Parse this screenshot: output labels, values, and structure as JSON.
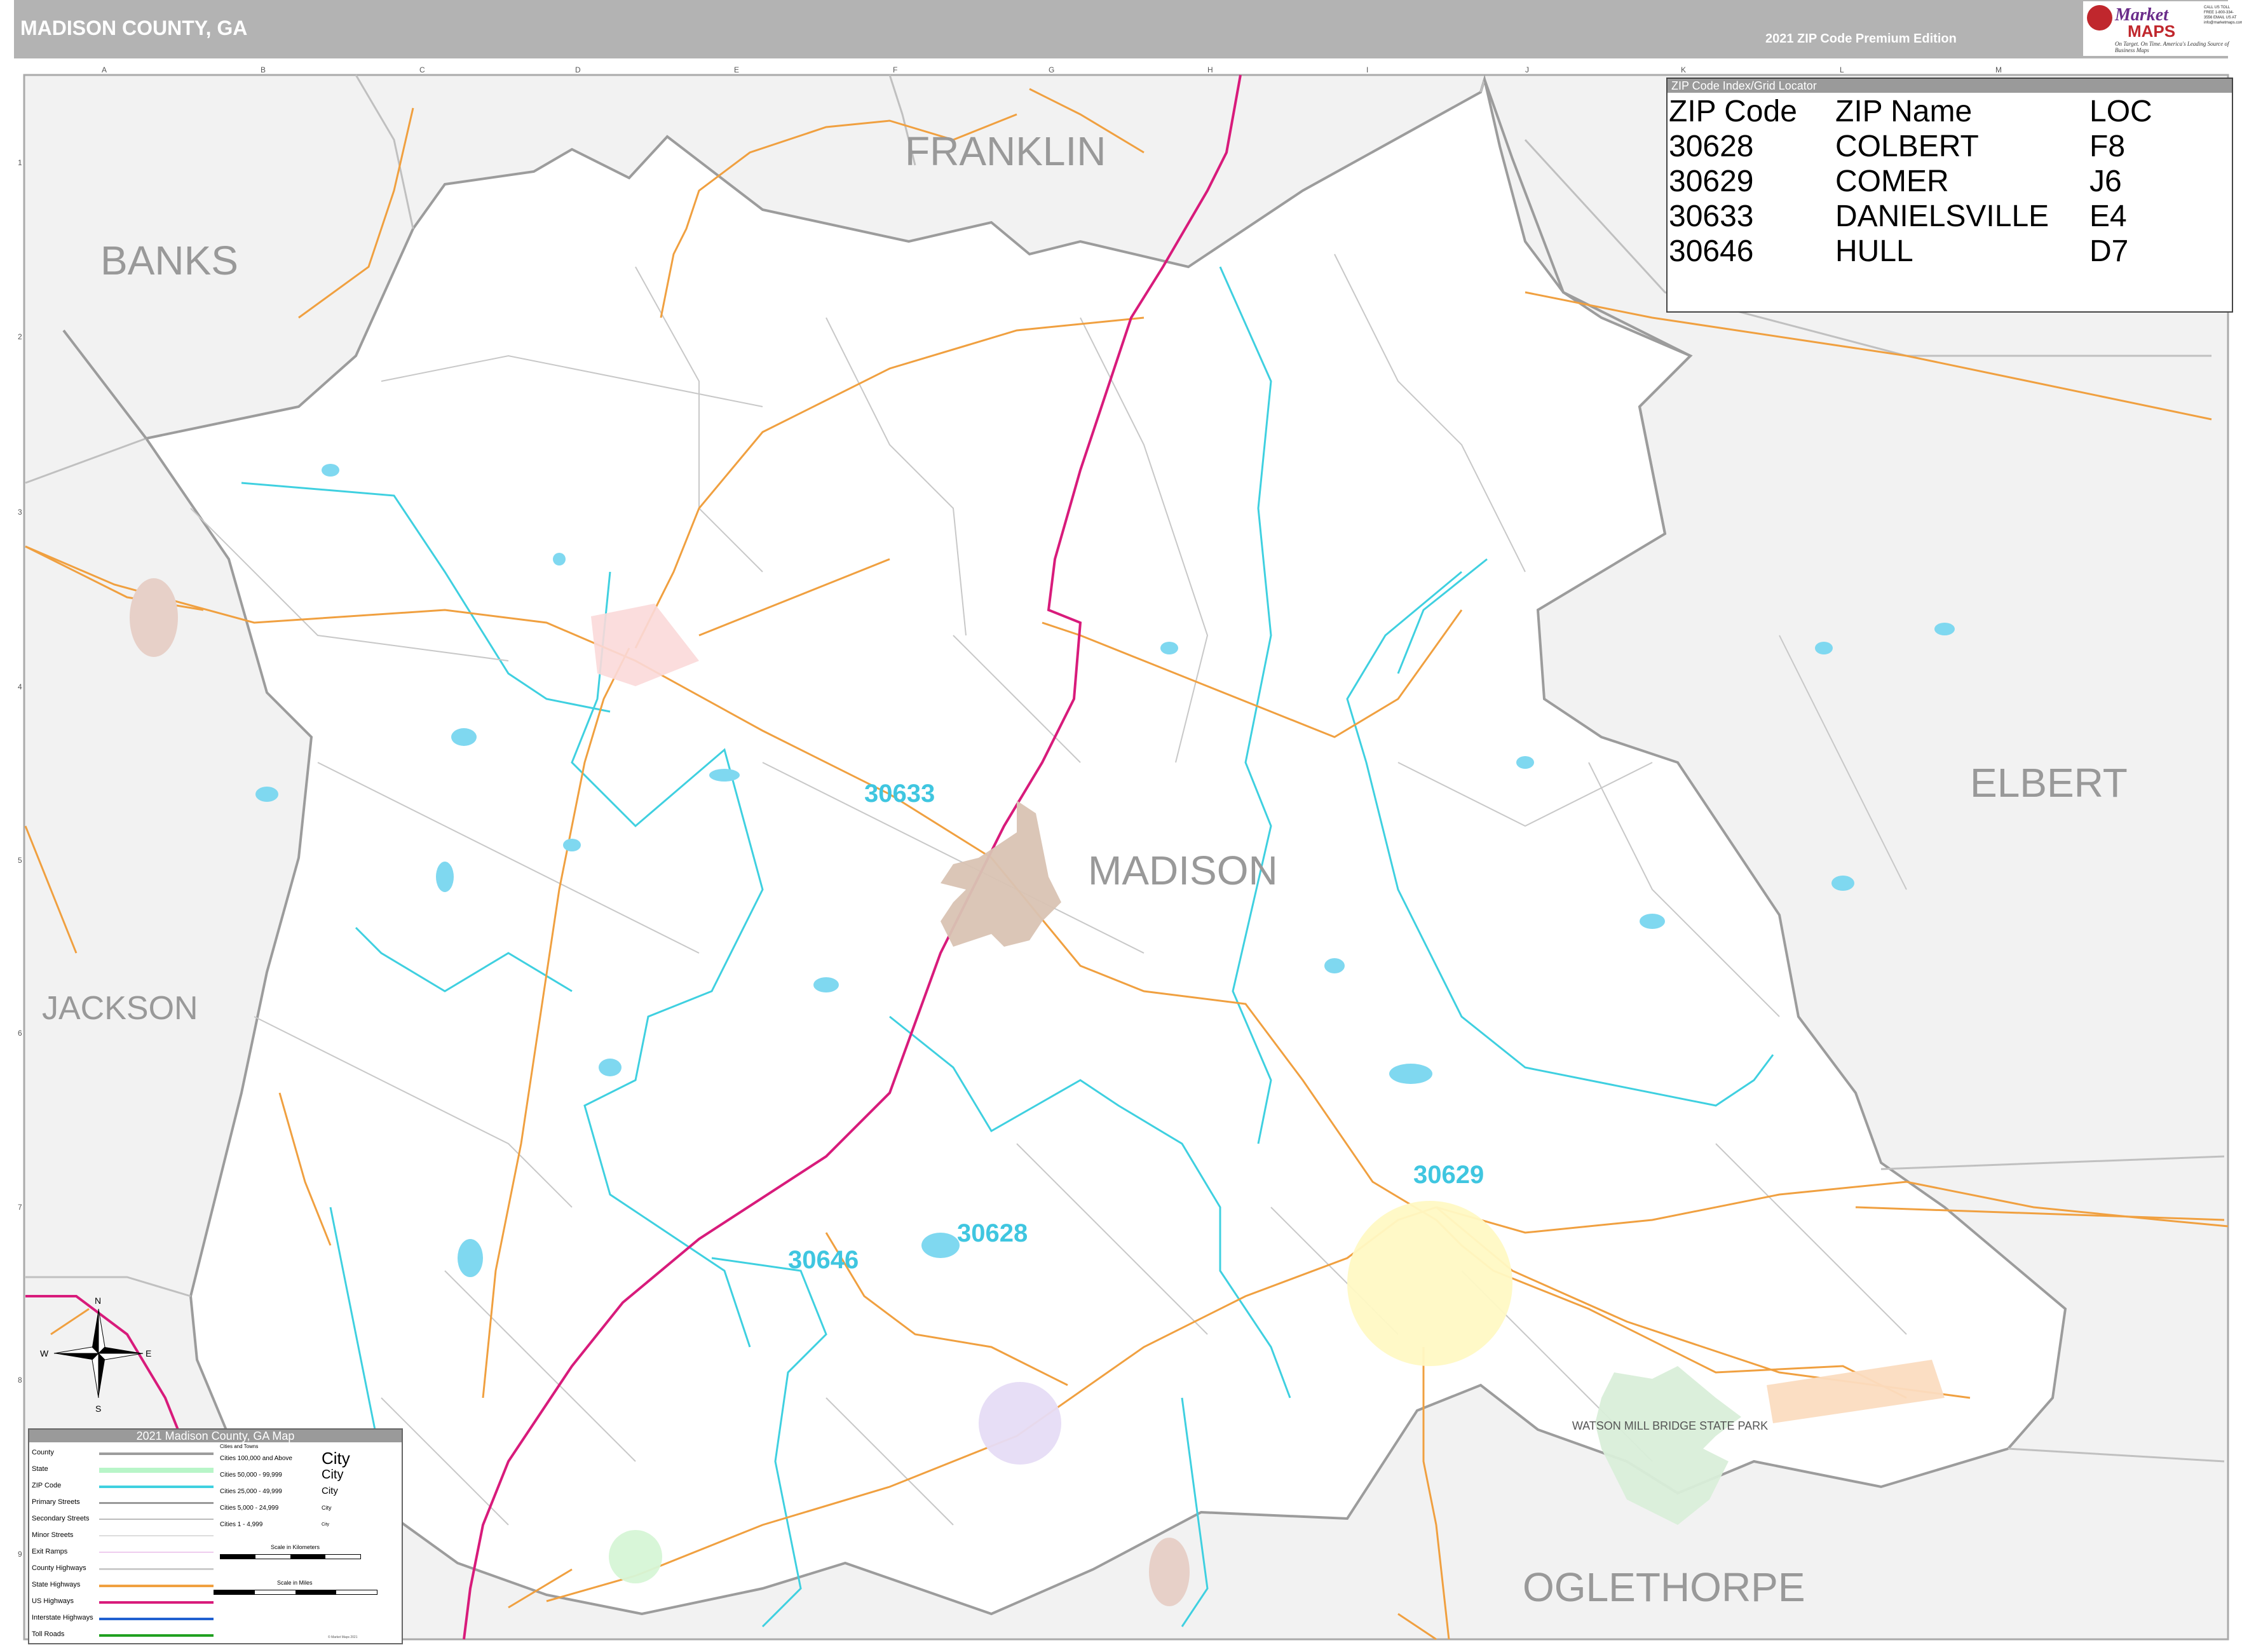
{
  "header": {
    "title": "MADISON COUNTY, GA",
    "edition": "2021 ZIP Code Premium Edition"
  },
  "logo": {
    "brand_line1": "Market",
    "brand_line2": "MAPS",
    "tagline": "On Target. On Time. America's Leading Source of Business Maps",
    "contact": "CALL US TOLL FREE 1-800-334-3556 EMAIL US AT info@marketmaps.com"
  },
  "map": {
    "counties": {
      "franklin": "FRANKLIN",
      "banks": "BANKS",
      "elbert": "ELBERT",
      "jackson": "JACKSON",
      "oglethorpe": "OGLETHORPE",
      "madison": "MADISON"
    },
    "zip_labels": [
      "30633",
      "30629",
      "30628",
      "30646"
    ],
    "park_label": "WATSON MILL BRIDGE STATE PARK",
    "grid_columns": [
      "A",
      "B",
      "C",
      "D",
      "E",
      "F",
      "G",
      "H",
      "I",
      "J",
      "K",
      "L",
      "M"
    ],
    "grid_rows": [
      "1",
      "2",
      "3",
      "4",
      "5",
      "6",
      "7",
      "8",
      "9"
    ],
    "compass": {
      "n": "N",
      "s": "S",
      "e": "E",
      "w": "W"
    },
    "colors": {
      "county_outside": "#f2f2f2",
      "county_inside": "#ffffff",
      "zip_boundary": "#3fd0e0",
      "county_border": "#9c9c9c",
      "us_highway": "#d81b7b",
      "state_highway": "#f0a040",
      "danielsville": "#d9c3b3",
      "comer": "#fff9c4",
      "colbert": "#e6dcf5",
      "hull": "#d6f5d6",
      "ila": "#fbd9d9",
      "carlton": "#fbdcc0",
      "park": "#d9eed9",
      "water": "#7fd8f0"
    }
  },
  "zip_table": {
    "title": "ZIP Code Index/Grid Locator",
    "headers": [
      "ZIP Code",
      "ZIP Name",
      "LOC"
    ],
    "rows": [
      [
        "30628",
        "COLBERT",
        "F8"
      ],
      [
        "30629",
        "COMER",
        "J6"
      ],
      [
        "30633",
        "DANIELSVILLE",
        "E4"
      ],
      [
        "30646",
        "HULL",
        "D7"
      ]
    ]
  },
  "legend": {
    "title": "2021 Madison County, GA Map",
    "items": [
      {
        "label": "County",
        "color": "#9c9c9c"
      },
      {
        "label": "State",
        "color": "#b8f5c8"
      },
      {
        "label": "ZIP Code",
        "color": "#3fd0e0"
      },
      {
        "label": "Primary Streets",
        "color": "#999999"
      },
      {
        "label": "Secondary Streets",
        "color": "#bbbbbb"
      },
      {
        "label": "Minor Streets",
        "color": "#dddddd"
      },
      {
        "label": "Exit Ramps",
        "color": "#eeccee"
      },
      {
        "label": "County Highways",
        "color": "#cccccc"
      },
      {
        "label": "State Highways",
        "color": "#f0a040"
      },
      {
        "label": "US Highways",
        "color": "#d81b7b"
      },
      {
        "label": "Interstate Highways",
        "color": "#2060d0"
      },
      {
        "label": "Toll Roads",
        "color": "#20a020"
      }
    ],
    "cities_header": "Cities and Towns",
    "cities": [
      {
        "label": "Cities 100,000 and Above",
        "sample": "City"
      },
      {
        "label": "Cities 50,000 - 99,999",
        "sample": "City"
      },
      {
        "label": "Cities 25,000 - 49,999",
        "sample": "City"
      },
      {
        "label": "Cities 5,000 - 24,999",
        "sample": "City"
      },
      {
        "label": "Cities 1 - 4,999",
        "sample": "City"
      }
    ],
    "scale_km": "Scale in Kilometers",
    "scale_mi": "Scale in Miles",
    "copyright": "© Market Maps 2021"
  }
}
